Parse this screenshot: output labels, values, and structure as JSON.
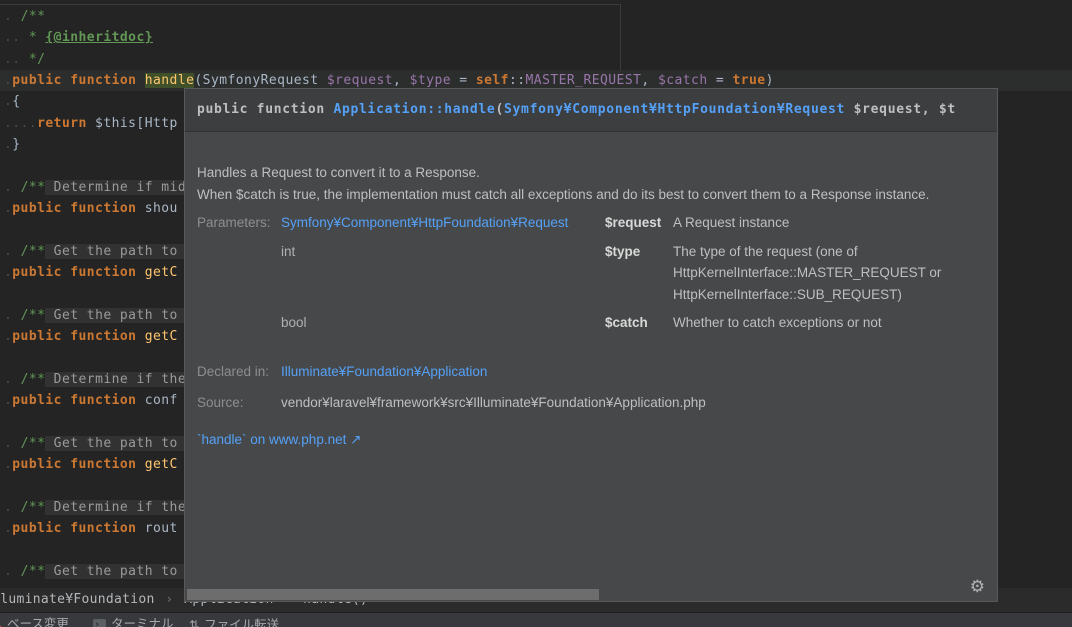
{
  "colors": {
    "editor_bg": "#242424",
    "popup_bg": "#474849",
    "popup_header_bg": "#3c3e3f",
    "link_blue": "#55a1f8",
    "keyword_orange": "#cc7832",
    "function_gold": "#ffc66d",
    "comment_green": "#629755",
    "variable_purple": "#9876aa",
    "status_bar_bg": "#37393c"
  },
  "editor": {
    "lines": [
      {
        "seg": [
          [
            "ws",
            ". "
          ],
          [
            "cm",
            "/**"
          ]
        ]
      },
      {
        "seg": [
          [
            "ws",
            ".. "
          ],
          [
            "cm",
            "* "
          ],
          [
            "cmtag",
            "{@inheritdoc}"
          ]
        ]
      },
      {
        "seg": [
          [
            "ws",
            ".. "
          ],
          [
            "cm",
            "*/"
          ]
        ]
      },
      {
        "hl": true,
        "seg": [
          [
            "ws",
            "."
          ],
          [
            "kw",
            "public function "
          ],
          [
            "fnhl",
            "handle"
          ],
          [
            "pl",
            "("
          ],
          [
            "id",
            "SymfonyRequest "
          ],
          [
            "var",
            "$request"
          ],
          [
            "pl",
            ", "
          ],
          [
            "var",
            "$type"
          ],
          [
            "pl",
            " = "
          ],
          [
            "kw",
            "self"
          ],
          [
            "pl",
            "::"
          ],
          [
            "var",
            "MASTER_REQUEST"
          ],
          [
            "pl",
            ", "
          ],
          [
            "var",
            "$catch"
          ],
          [
            "pl",
            " = "
          ],
          [
            "bool",
            "true"
          ],
          [
            "pl",
            ")"
          ]
        ]
      },
      {
        "seg": [
          [
            "ws",
            "."
          ],
          [
            "pl",
            "{"
          ]
        ]
      },
      {
        "seg": [
          [
            "ws",
            "...."
          ],
          [
            "kw",
            "return "
          ],
          [
            "pl",
            "$this[Http"
          ]
        ]
      },
      {
        "seg": [
          [
            "ws",
            "."
          ],
          [
            "pl",
            "}"
          ]
        ]
      },
      {
        "seg": []
      },
      {
        "seg": [
          [
            "ws",
            ". "
          ],
          [
            "cm",
            "/**"
          ],
          [
            "fold",
            " Determine if midd"
          ]
        ]
      },
      {
        "seg": [
          [
            "ws",
            "."
          ],
          [
            "kw",
            "public function "
          ],
          [
            "id",
            "shou"
          ]
        ]
      },
      {
        "seg": []
      },
      {
        "seg": [
          [
            "ws",
            ". "
          ],
          [
            "cm",
            "/**"
          ],
          [
            "fold",
            " Get the path to th"
          ]
        ]
      },
      {
        "seg": [
          [
            "ws",
            "."
          ],
          [
            "kw",
            "public function "
          ],
          [
            "fn",
            "getC"
          ]
        ]
      },
      {
        "seg": []
      },
      {
        "seg": [
          [
            "ws",
            ". "
          ],
          [
            "cm",
            "/**"
          ],
          [
            "fold",
            " Get the path to th"
          ]
        ]
      },
      {
        "seg": [
          [
            "ws",
            "."
          ],
          [
            "kw",
            "public function "
          ],
          [
            "fn",
            "getC"
          ]
        ]
      },
      {
        "seg": []
      },
      {
        "seg": [
          [
            "ws",
            ". "
          ],
          [
            "cm",
            "/**"
          ],
          [
            "fold",
            " Determine if the a"
          ]
        ]
      },
      {
        "seg": [
          [
            "ws",
            "."
          ],
          [
            "kw",
            "public function "
          ],
          [
            "id",
            "conf"
          ]
        ]
      },
      {
        "seg": []
      },
      {
        "seg": [
          [
            "ws",
            ". "
          ],
          [
            "cm",
            "/**"
          ],
          [
            "fold",
            " Get the path to th"
          ]
        ]
      },
      {
        "seg": [
          [
            "ws",
            "."
          ],
          [
            "kw",
            "public function "
          ],
          [
            "fn",
            "getC"
          ]
        ]
      },
      {
        "seg": []
      },
      {
        "seg": [
          [
            "ws",
            ". "
          ],
          [
            "cm",
            "/**"
          ],
          [
            "fold",
            " Determine if the a"
          ]
        ]
      },
      {
        "seg": [
          [
            "ws",
            "."
          ],
          [
            "kw",
            "public function "
          ],
          [
            "id",
            "rout"
          ]
        ]
      },
      {
        "seg": []
      },
      {
        "seg": [
          [
            "ws",
            ". "
          ],
          [
            "cm",
            "/**"
          ],
          [
            "fold",
            " Get the path to th"
          ]
        ]
      }
    ]
  },
  "popup": {
    "header_segments": [
      [
        "pl",
        "public function "
      ],
      [
        "link",
        "Application::handle"
      ],
      [
        "pl",
        "("
      ],
      [
        "link",
        "Symfony¥Component¥HttpFoundation¥Request"
      ],
      [
        "pl",
        " $request, $t"
      ]
    ],
    "description": [
      "Handles a Request to convert it to a Response.",
      "When $catch is true, the implementation must catch all exceptions and do its best to convert them to a Response instance."
    ],
    "parameters_label": "Parameters:",
    "parameters": [
      {
        "type": "Symfony¥Component¥HttpFoundation¥Request",
        "type_is_link": true,
        "name": "$request",
        "desc": "A Request instance"
      },
      {
        "type": "int",
        "type_is_link": false,
        "name": "$type",
        "desc": "The type of the request (one of HttpKernelInterface::MASTER_REQUEST or HttpKernelInterface::SUB_REQUEST)"
      },
      {
        "type": "bool",
        "type_is_link": false,
        "name": "$catch",
        "desc": "Whether to catch exceptions or not"
      }
    ],
    "declared_in_label": "Declared in:",
    "declared_in_value": "Illuminate¥Foundation¥Application",
    "source_label": "Source:",
    "source_value": "vendor¥laravel¥framework¥src¥Illuminate¥Foundation¥Application.php",
    "php_link_text": "`handle` on www.php.net",
    "php_link_arrow": "↗",
    "gear_glyph": "⚙"
  },
  "breadcrumbs": {
    "items": [
      "Illuminate¥Foundation",
      "Application",
      "handle()"
    ],
    "separator": "›"
  },
  "status_bar": {
    "items": [
      {
        "icon": "red-flag",
        "label": "ベース変更"
      },
      {
        "icon": "terminal",
        "label": "ターミナル"
      },
      {
        "icon": "file-transfer",
        "label": "ファイル転送"
      }
    ],
    "terminal_icon_glyph": "›_"
  }
}
